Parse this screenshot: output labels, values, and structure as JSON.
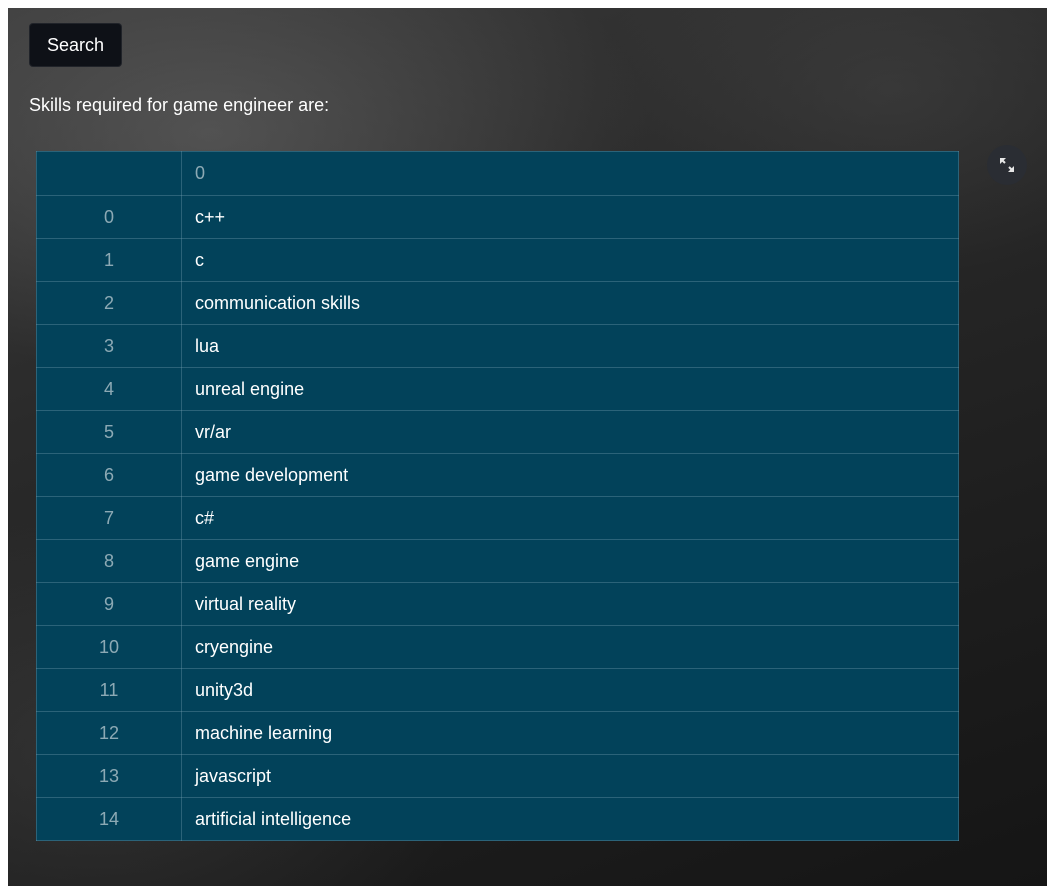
{
  "search": {
    "label": "Search"
  },
  "caption": "Skills required for game engineer are:",
  "table": {
    "header_index": "",
    "header_value": "0",
    "rows": [
      {
        "index": "0",
        "value": "c++"
      },
      {
        "index": "1",
        "value": "c"
      },
      {
        "index": "2",
        "value": "communication skills"
      },
      {
        "index": "3",
        "value": "lua"
      },
      {
        "index": "4",
        "value": "unreal engine"
      },
      {
        "index": "5",
        "value": "vr/ar"
      },
      {
        "index": "6",
        "value": "game development"
      },
      {
        "index": "7",
        "value": "c#"
      },
      {
        "index": "8",
        "value": "game engine"
      },
      {
        "index": "9",
        "value": "virtual reality"
      },
      {
        "index": "10",
        "value": "cryengine"
      },
      {
        "index": "11",
        "value": "unity3d"
      },
      {
        "index": "12",
        "value": "machine learning"
      },
      {
        "index": "13",
        "value": "javascript"
      },
      {
        "index": "14",
        "value": "artificial intelligence"
      }
    ]
  },
  "icons": {
    "expand": "fullscreen-expand-icon"
  },
  "colors": {
    "table_bg": "#02425a",
    "button_bg": "#0e1117",
    "text": "#ffffff"
  }
}
